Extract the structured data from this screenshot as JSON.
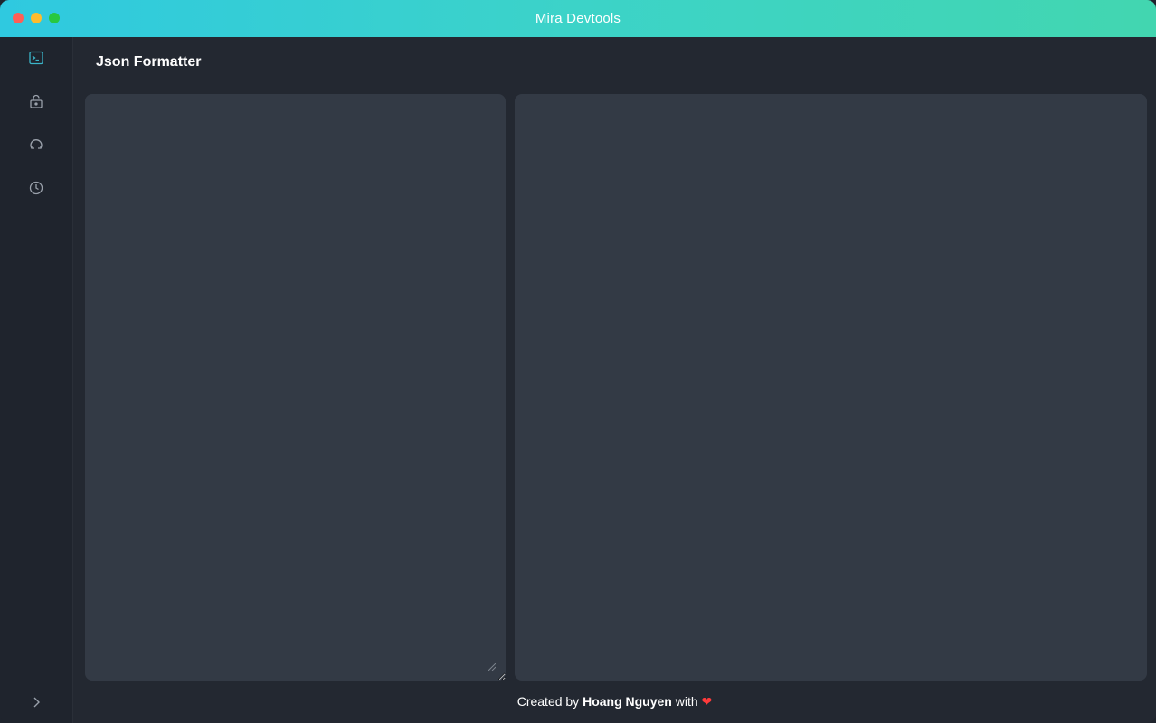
{
  "window": {
    "title": "Mira Devtools"
  },
  "sidebar": {
    "items": [
      {
        "name": "terminal",
        "active": true
      },
      {
        "name": "unlock",
        "active": false
      },
      {
        "name": "refresh",
        "active": false
      },
      {
        "name": "clock",
        "active": false
      }
    ],
    "expand_icon": "chevron-right-icon"
  },
  "main": {
    "title": "Json Formatter",
    "input": {
      "value": "",
      "placeholder": ""
    },
    "output": {
      "value": ""
    }
  },
  "footer": {
    "prefix": "Created by",
    "author": "Hoang Nguyen",
    "suffix": "with",
    "heart": "❤"
  },
  "colors": {
    "accent": "#2fc9e0",
    "active_icon": "#3bb5c9",
    "icon": "#9aa1ab",
    "panel": "#333a45",
    "background": "#232831",
    "heart": "#ff3b3b"
  }
}
